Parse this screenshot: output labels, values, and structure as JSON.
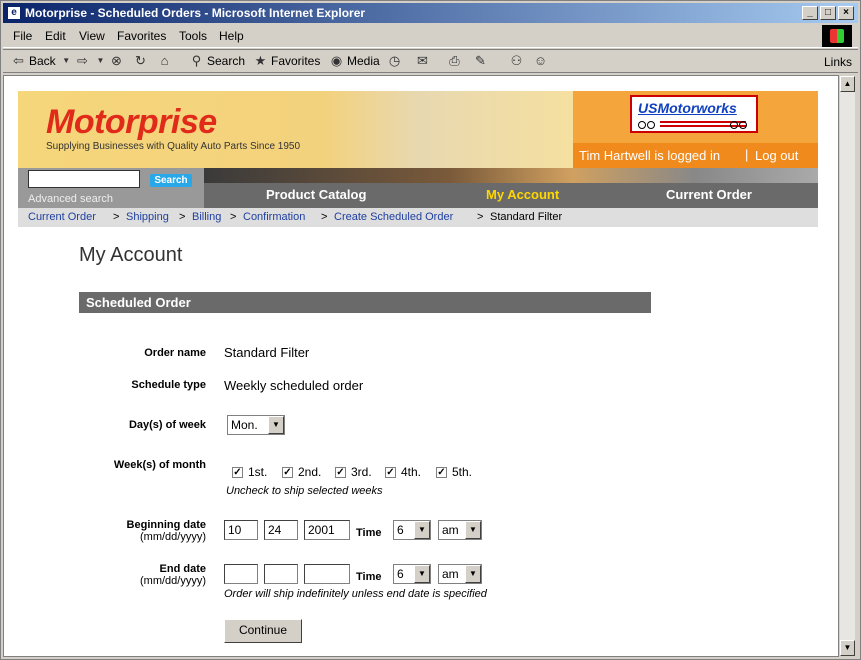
{
  "window": {
    "title": "Motorprise - Scheduled Orders - Microsoft Internet Explorer",
    "buttons": [
      "_",
      "□",
      "×"
    ]
  },
  "menu": [
    "File",
    "Edit",
    "View",
    "Favorites",
    "Tools",
    "Help"
  ],
  "toolbar": {
    "back": "Back",
    "search": "Search",
    "favorites": "Favorites",
    "media": "Media",
    "links": "Links"
  },
  "header": {
    "brand": "Motorprise",
    "tagline": "Supplying Businesses with Quality Auto Parts Since 1950",
    "partner_logo": "USMotorworks",
    "user": "Tim Hartwell is logged in",
    "separator": "|",
    "logout": "Log out"
  },
  "search": {
    "button": "Search",
    "advanced": "Advanced search"
  },
  "nav": {
    "catalog": "Product Catalog",
    "account": "My Account",
    "order": "Current Order",
    "active_color": "#ffd700"
  },
  "breadcrumbs": [
    {
      "label": "Current Order"
    },
    {
      "label": "Shipping"
    },
    {
      "label": "Billing"
    },
    {
      "label": "Confirmation"
    },
    {
      "label": "Create Scheduled Order"
    },
    {
      "label": "Standard Filter"
    }
  ],
  "crumb_sep": ">",
  "page": {
    "title": "My Account",
    "section": "Scheduled Order"
  },
  "form": {
    "order_name_label": "Order name",
    "order_name": "Standard Filter",
    "schedule_type_label": "Schedule type",
    "schedule_type": "Weekly scheduled order",
    "days_label": "Day(s) of week",
    "day_value": "Mon.",
    "weeks_label": "Week(s) of month",
    "weeks": [
      {
        "label": "1st.",
        "checked": true
      },
      {
        "label": "2nd.",
        "checked": true
      },
      {
        "label": "3rd.",
        "checked": true
      },
      {
        "label": "4th.",
        "checked": true
      },
      {
        "label": "5th.",
        "checked": true
      }
    ],
    "weeks_note": "Uncheck to ship selected weeks",
    "begin_label": "Beginning date",
    "date_format": "(mm/dd/yyyy)",
    "begin_mm": "10",
    "begin_dd": "24",
    "begin_yyyy": "2001",
    "time_label": "Time",
    "begin_hour": "6",
    "begin_ampm": "am",
    "end_label": "End date",
    "end_mm": "",
    "end_dd": "",
    "end_yyyy": "",
    "end_hour": "6",
    "end_ampm": "am",
    "end_note": "Order will ship indefinitely unless end date is specified",
    "continue": "Continue"
  }
}
